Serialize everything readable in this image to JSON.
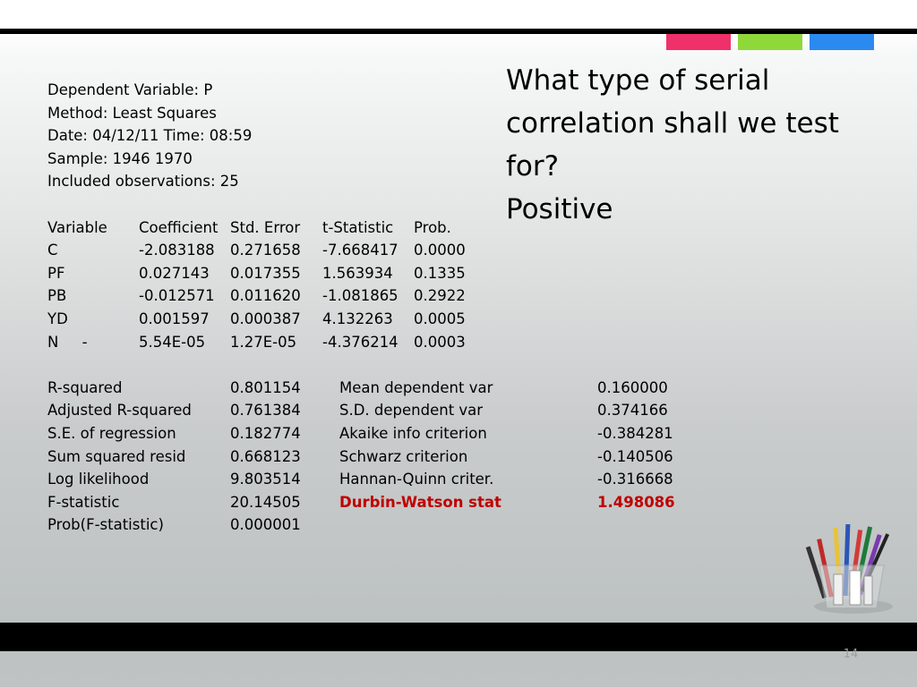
{
  "regression": {
    "header_lines": [
      "Dependent Variable: P",
      "Method: Least Squares",
      "Date: 04/12/11   Time: 08:59",
      "Sample: 1946 1970",
      "Included observations: 25"
    ],
    "coef_table": {
      "headers": [
        "Variable",
        "Coefficient",
        "Std. Error",
        "t-Statistic",
        "Prob."
      ],
      "rows": [
        [
          "C",
          "-2.083188",
          "0.271658",
          "-7.668417",
          "0.0000"
        ],
        [
          "PF",
          "0.027143",
          "0.017355",
          "1.563934",
          "0.1335"
        ],
        [
          "PB",
          "-0.012571",
          "0.011620",
          "-1.081865",
          "0.2922"
        ],
        [
          "YD",
          "0.001597",
          "0.000387",
          "4.132263",
          "0.0005"
        ],
        [
          "N     -",
          "5.54E-05",
          "1.27E-05",
          "-4.376214",
          "0.0003"
        ]
      ]
    },
    "stats": [
      [
        "R-squared",
        "0.801154",
        "Mean dependent var",
        "0.160000"
      ],
      [
        "Adjusted R-squared",
        "0.761384",
        "S.D. dependent var",
        "0.374166"
      ],
      [
        "S.E. of regression",
        "0.182774",
        "Akaike info criterion",
        "-0.384281"
      ],
      [
        "Sum squared resid",
        "0.668123",
        "Schwarz criterion",
        "-0.140506"
      ],
      [
        "Log likelihood",
        "9.803514",
        "Hannan-Quinn criter.",
        "-0.316668"
      ],
      [
        "F-statistic",
        "20.14505",
        "Durbin-Watson stat",
        "1.498086"
      ],
      [
        "Prob(F-statistic)",
        "0.000001",
        "",
        ""
      ]
    ],
    "highlight_color": "#c00000"
  },
  "question": {
    "line1": "What type of serial",
    "line2": "correlation shall we test",
    "line3": "for?",
    "answer": "Positive"
  },
  "page_number": "14",
  "accent_colors": [
    "#f0306a",
    "#8fd83a",
    "#2b8af0"
  ]
}
